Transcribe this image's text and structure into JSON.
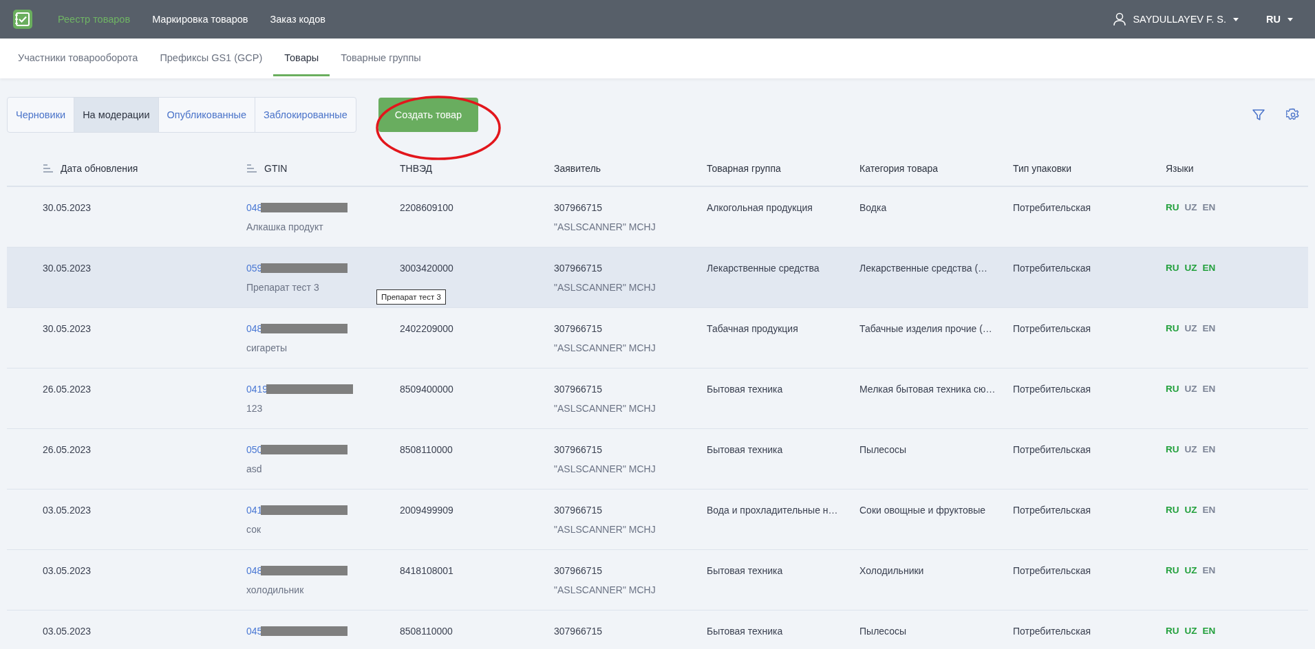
{
  "topbar": {
    "nav": [
      {
        "label": "Реестр товаров",
        "selected": true
      },
      {
        "label": "Маркировка товаров",
        "selected": false
      },
      {
        "label": "Заказ кодов",
        "selected": false
      }
    ],
    "user": "SAYDULLAYEV F. S.",
    "language": "RU"
  },
  "subnav": [
    {
      "label": "Участники товарооборота",
      "selected": false
    },
    {
      "label": "Префиксы GS1 (GCP)",
      "selected": false
    },
    {
      "label": "Товары",
      "selected": true
    },
    {
      "label": "Товарные группы",
      "selected": false
    }
  ],
  "status_tabs": [
    {
      "label": "Черновики",
      "selected": false
    },
    {
      "label": "На модерации",
      "selected": true
    },
    {
      "label": "Опубликованные",
      "selected": false
    },
    {
      "label": "Заблокированные",
      "selected": false
    }
  ],
  "create_button": "Создать товар",
  "table": {
    "columns": [
      {
        "label": "Дата обновления",
        "sortable": true
      },
      {
        "label": "GTIN",
        "sortable": true
      },
      {
        "label": "ТНВЭД",
        "sortable": false
      },
      {
        "label": "Заявитель",
        "sortable": false
      },
      {
        "label": "Товарная группа",
        "sortable": false
      },
      {
        "label": "Категория товара",
        "sortable": false
      },
      {
        "label": "Тип упаковки",
        "sortable": false
      },
      {
        "label": "Языки",
        "sortable": false
      }
    ],
    "rows": [
      {
        "date": "30.05.2023",
        "gtin": "048",
        "name": "Алкашка продукт",
        "tnved": "2208609100",
        "applicant_id": "307966715",
        "applicant_name": "\"ASLSCANNER\" MCHJ",
        "group": "Алкогольная продукция",
        "category": "Водка",
        "package": "Потребительская",
        "highlighted": false,
        "languages": [
          {
            "code": "RU",
            "filled": true
          },
          {
            "code": "UZ",
            "filled": false
          },
          {
            "code": "EN",
            "filled": false
          }
        ]
      },
      {
        "date": "30.05.2023",
        "gtin": "059",
        "name": "Препарат тест 3",
        "tnved": "3003420000",
        "applicant_id": "307966715",
        "applicant_name": "\"ASLSCANNER\" MCHJ",
        "group": "Лекарственные средства",
        "category": "Лекарственные средства (…",
        "package": "Потребительская",
        "highlighted": true,
        "tooltip": "Препарат тест 3",
        "languages": [
          {
            "code": "RU",
            "filled": true
          },
          {
            "code": "UZ",
            "filled": true
          },
          {
            "code": "EN",
            "filled": true
          }
        ]
      },
      {
        "date": "30.05.2023",
        "gtin": "048",
        "name": "сигареты",
        "tnved": "2402209000",
        "applicant_id": "307966715",
        "applicant_name": "\"ASLSCANNER\" MCHJ",
        "group": "Табачная продукция",
        "category": "Табачные изделия прочие (…",
        "package": "Потребительская",
        "highlighted": false,
        "languages": [
          {
            "code": "RU",
            "filled": true
          },
          {
            "code": "UZ",
            "filled": false
          },
          {
            "code": "EN",
            "filled": false
          }
        ]
      },
      {
        "date": "26.05.2023",
        "gtin": "0419",
        "name": "123",
        "tnved": "8509400000",
        "applicant_id": "307966715",
        "applicant_name": "\"ASLSCANNER\" MCHJ",
        "group": "Бытовая техника",
        "category": "Мелкая бытовая техника сю…",
        "package": "Потребительская",
        "highlighted": false,
        "languages": [
          {
            "code": "RU",
            "filled": true
          },
          {
            "code": "UZ",
            "filled": false
          },
          {
            "code": "EN",
            "filled": false
          }
        ]
      },
      {
        "date": "26.05.2023",
        "gtin": "050",
        "name": "asd",
        "tnved": "8508110000",
        "applicant_id": "307966715",
        "applicant_name": "\"ASLSCANNER\" MCHJ",
        "group": "Бытовая техника",
        "category": "Пылесосы",
        "package": "Потребительская",
        "highlighted": false,
        "languages": [
          {
            "code": "RU",
            "filled": true
          },
          {
            "code": "UZ",
            "filled": false
          },
          {
            "code": "EN",
            "filled": false
          }
        ]
      },
      {
        "date": "03.05.2023",
        "gtin": "041",
        "name": "сок",
        "tnved": "2009499909",
        "applicant_id": "307966715",
        "applicant_name": "\"ASLSCANNER\" MCHJ",
        "group": "Вода и прохладительные н…",
        "category": "Соки овощные и фруктовые",
        "package": "Потребительская",
        "highlighted": false,
        "languages": [
          {
            "code": "RU",
            "filled": true
          },
          {
            "code": "UZ",
            "filled": true
          },
          {
            "code": "EN",
            "filled": false
          }
        ]
      },
      {
        "date": "03.05.2023",
        "gtin": "048",
        "name": "холодильник",
        "tnved": "8418108001",
        "applicant_id": "307966715",
        "applicant_name": "\"ASLSCANNER\" MCHJ",
        "group": "Бытовая техника",
        "category": "Холодильники",
        "package": "Потребительская",
        "highlighted": false,
        "languages": [
          {
            "code": "RU",
            "filled": true
          },
          {
            "code": "UZ",
            "filled": true
          },
          {
            "code": "EN",
            "filled": false
          }
        ]
      },
      {
        "date": "03.05.2023",
        "gtin": "045",
        "tnved": "8508110000",
        "applicant_id": "307966715",
        "group": "Бытовая техника",
        "category": "Пылесосы",
        "package": "Потребительская",
        "highlighted": false,
        "languages": [
          {
            "code": "RU",
            "filled": true
          },
          {
            "code": "UZ",
            "filled": true
          },
          {
            "code": "EN",
            "filled": true
          }
        ]
      }
    ]
  }
}
